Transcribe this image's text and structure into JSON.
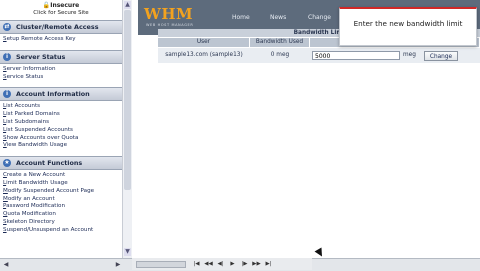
{
  "sidebar": {
    "insecure_title": "Insecure",
    "insecure_link": "Click for Secure Site",
    "sections": [
      {
        "title": "Cluster/Remote Access",
        "items": [
          "Setup Remote Access Key"
        ]
      },
      {
        "title": "Server Status",
        "items": [
          "Server Information",
          "Service Status"
        ]
      },
      {
        "title": "Account Information",
        "items": [
          "List Accounts",
          "List Parked Domains",
          "List Subdomains",
          "List Suspended Accounts",
          "Show Accounts over Quota",
          "View Bandwidth Usage"
        ]
      },
      {
        "title": "Account Functions",
        "items": [
          "Create a New Account",
          "Limit Bandwidth Usage",
          "Modify Suspended Account Page",
          "Modify an Account",
          "Password Modification",
          "Quota Modification",
          "Skeleton Directory",
          "Suspend/Unsuspend an Account"
        ]
      }
    ]
  },
  "header": {
    "logo": "WHM",
    "logo_sub": "WEB HOST MANAGER",
    "nav": [
      "Home",
      "News",
      "Change"
    ]
  },
  "panel": {
    "title": "Bandwidth Limi",
    "columns": [
      "User",
      "Bandwidth Used",
      ""
    ],
    "row": {
      "user": "sample13.com (sample13)",
      "used": "0 meg",
      "limit_value": "5000",
      "unit": "meg",
      "button": "Change"
    }
  },
  "tooltip": {
    "text": "Enter the new bandwidth limit"
  },
  "colors": {
    "header_bg": "#5d6b7c",
    "logo": "#f2a21f",
    "tooltip_accent": "#d02828"
  }
}
